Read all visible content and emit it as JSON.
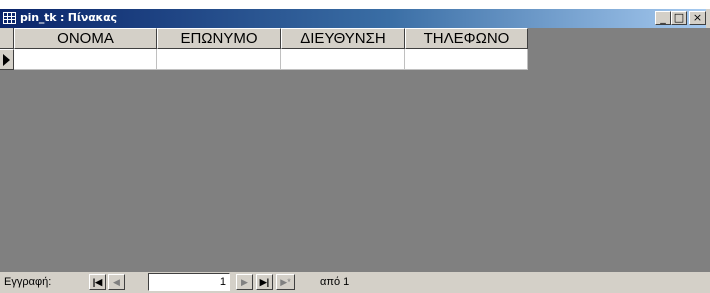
{
  "window": {
    "title": "pin_tk : Πίνακας",
    "icon": "table-icon",
    "minimize_label": "_",
    "maximize_label": "□",
    "close_label": "×"
  },
  "datasheet": {
    "columns": [
      "ΟΝΟΜΑ",
      "ΕΠΩΝΥΜΟ",
      "ΔΙΕΥΘΥΝΣΗ",
      "ΤΗΛΕΦΩΝΟ"
    ],
    "rows": [
      [
        "",
        "",
        "",
        ""
      ]
    ],
    "row_selector_icon": "current-record-arrow-icon"
  },
  "navigation": {
    "label": "Εγγραφή:",
    "first_label": "|◀",
    "prev_label": "◀",
    "current_record": "1",
    "next_label": "▶",
    "last_label": "▶|",
    "new_label": "▶*",
    "of_label": "από 1"
  },
  "colors": {
    "titlebar_start": "#0a246a",
    "titlebar_end": "#a6caf0",
    "grid_background": "#808080",
    "chrome": "#d4d0c8"
  }
}
